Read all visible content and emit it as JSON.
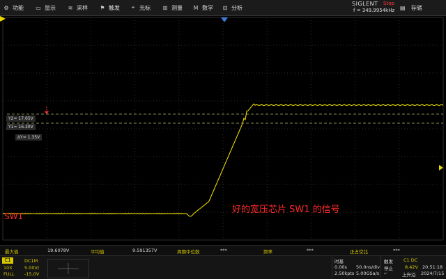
{
  "menu": {
    "items": [
      {
        "label": "功能",
        "icon": "gear-icon",
        "glyph": "⚙"
      },
      {
        "label": "显示",
        "icon": "display-icon",
        "glyph": "▭"
      },
      {
        "label": "采样",
        "icon": "sampling-icon",
        "glyph": "≋"
      },
      {
        "label": "触发",
        "icon": "trigger-icon",
        "glyph": "⚑"
      },
      {
        "label": "光标",
        "icon": "cursor-icon",
        "glyph": "⌖"
      },
      {
        "label": "测量",
        "icon": "measure-icon",
        "glyph": "⊞"
      },
      {
        "label": "数学",
        "icon": "math-icon",
        "glyph": "M"
      },
      {
        "label": "分析",
        "icon": "analysis-icon",
        "glyph": "⊟"
      }
    ],
    "brand": "SIGLENT",
    "run_state": "Stop",
    "frequency": "f = 349.9954kHz",
    "save_label": "存储"
  },
  "cursors": {
    "y2_label": "Y2= 17.65V",
    "y1_label": "Y1= 16.30V",
    "delta_label": "ΔY= 1.35V"
  },
  "channel_marker_text": "SW1",
  "annotation_text": "好的宽压芯片 SW1 的信号",
  "measurements": {
    "max_label": "最大值",
    "max_value": "19.6078V",
    "mean_label": "平均值",
    "mean_value": "9.591357V",
    "period_mid_label": "周期中位数",
    "period_mid_value": "***",
    "freq_label": "频率",
    "freq_value": "***",
    "pos_duty_label": "正占空比",
    "pos_duty_value": "***"
  },
  "channel": {
    "name": "C1",
    "coupling": "DC1M",
    "probe": "10X",
    "scale": "5.00V/",
    "bandwidth": "FULL",
    "offset": "-15.0V"
  },
  "timebase": {
    "title": "时基",
    "delay": "0.00s",
    "scale": "50.0ns/div",
    "memory": "2.50kpts",
    "sample_rate": "5.00GSa/s"
  },
  "trigger": {
    "title": "触发",
    "source": "C1 DC",
    "mode": "停止",
    "level": "8.42V",
    "slope": "上升沿"
  },
  "clock": {
    "time": "20:51:18",
    "date": "2024/7/15"
  },
  "colors": {
    "trace": "#e8d800",
    "annotation": "#ff2a2a",
    "grid": "#2e2e2e"
  }
}
